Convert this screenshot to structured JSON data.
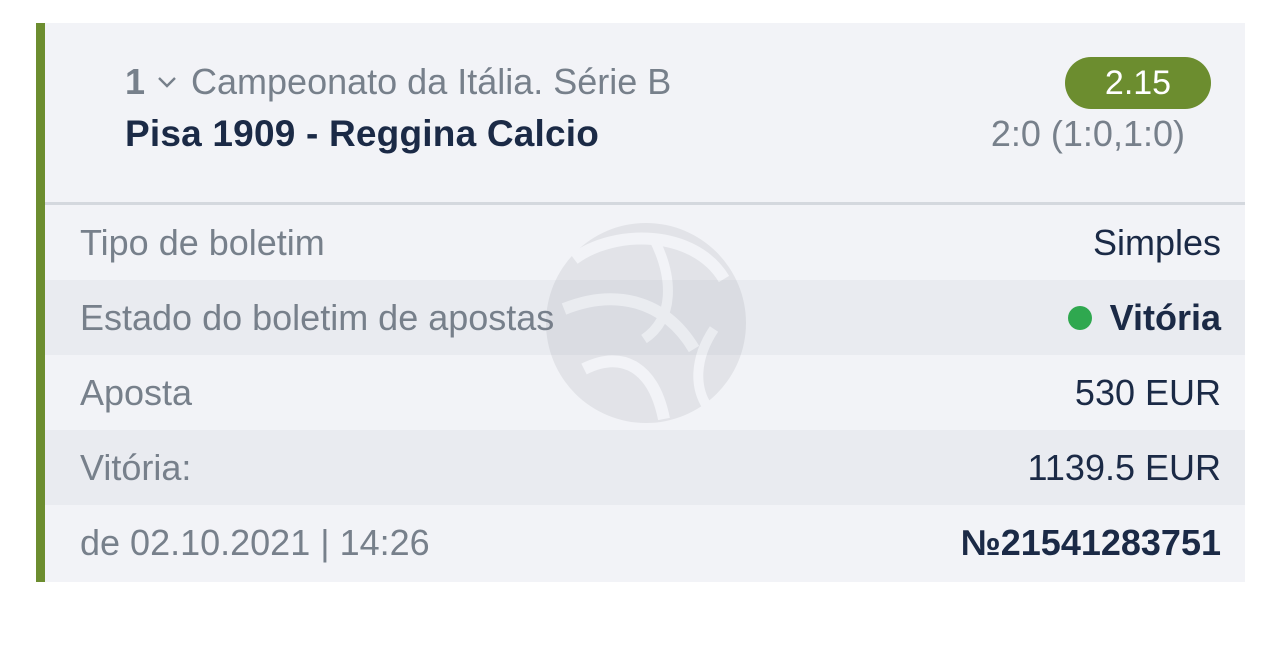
{
  "bet": {
    "event_number": "1",
    "league": "Campeonato da Itália. Série B",
    "match": "Pisa 1909 - Reggina Calcio",
    "odds": "2.15",
    "score": "2:0 (1:0,1:0)"
  },
  "details": {
    "type_label": "Tipo de boletim",
    "type_value": "Simples",
    "status_label": "Estado do boletim de apostas",
    "status_value": "Vitória",
    "stake_label": "Aposta",
    "stake_value": "530 EUR",
    "win_label": "Vitória:",
    "win_value": "1139.5 EUR",
    "date_text": "de 02.10.2021 | 14:26",
    "bet_number": "№21541283751"
  },
  "colors": {
    "accent": "#6c8d2f",
    "status_won": "#2fa84f",
    "text_dark": "#1b2a46",
    "text_muted": "#77808b"
  },
  "icons": {
    "expand": "chevron-down-icon",
    "watermark": "ball-logo-icon",
    "status": "status-dot-icon"
  }
}
